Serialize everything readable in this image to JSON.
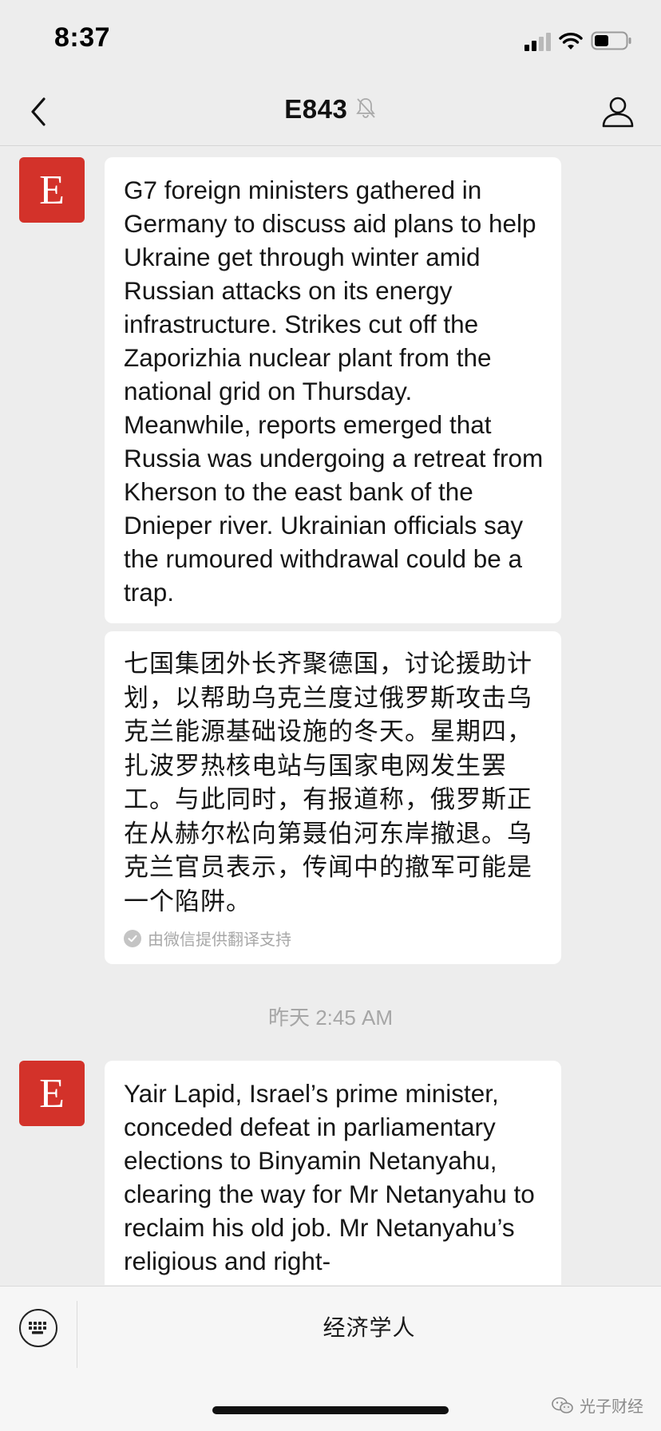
{
  "status_bar": {
    "time": "8:37",
    "icons": [
      "cellular-signal-icon",
      "wifi-icon",
      "battery-icon"
    ]
  },
  "nav": {
    "back_icon": "chevron-left-icon",
    "title": "E843",
    "mute_icon": "bell-muted-icon",
    "profile_icon": "person-icon"
  },
  "messages": [
    {
      "avatar_letter": "E",
      "text": "G7 foreign ministers gathered in Germany to discuss aid plans to help Ukraine get through winter amid Russian attacks on its energy infrastructure. Strikes cut off the Zaporizhia nuclear plant from the national grid on Thursday. Meanwhile, reports emerged that Russia was undergoing a retreat from Kherson to the east bank of the Dnieper river. Ukrainian officials say the rumoured withdrawal could be a trap.",
      "translation": "七国集团外长齐聚德国，讨论援助计划，以帮助乌克兰度过俄罗斯攻击乌克兰能源基础设施的冬天。星期四，扎波罗热核电站与国家电网发生罢工。与此同时，有报道称，俄罗斯正在从赫尔松向第聂伯河东岸撤退。乌克兰官员表示，传闻中的撤军可能是一个陷阱。",
      "translation_note": "由微信提供翻译支持"
    },
    {
      "avatar_letter": "E",
      "text": "Yair Lapid, Israel’s prime minister, conceded defeat in parliamentary elections to Binyamin Netanyahu, clearing the way for Mr Netanyahu to reclaim his old job. Mr Netanyahu’s religious and right-"
    }
  ],
  "timestamp": "昨天 2:45 AM",
  "bottom_bar": {
    "keyboard_icon": "keyboard-icon",
    "menu_label": "经济学人",
    "watermark_text": "光子财经",
    "watermark_icon": "wechat-logo-icon"
  },
  "colors": {
    "background": "#ededed",
    "bubble": "#ffffff",
    "avatar": "#d3322a",
    "timestamp": "#a6a6a6"
  }
}
